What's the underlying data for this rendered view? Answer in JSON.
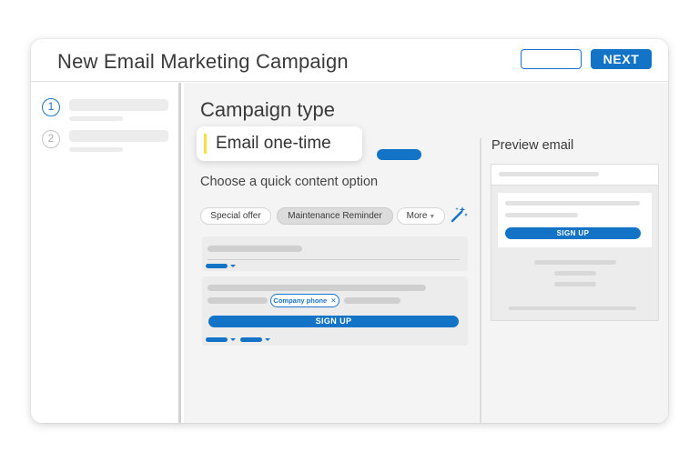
{
  "header": {
    "title": "New Email Marketing Campaign",
    "next_label": "NEXT"
  },
  "sidebar": {
    "steps": [
      {
        "number": "1",
        "state": "active"
      },
      {
        "number": "2",
        "state": "inactive"
      }
    ]
  },
  "main": {
    "title": "Campaign type",
    "selected_type": "Email one-time",
    "subheading": "Choose a quick content option",
    "chips": [
      {
        "label": "Special offer"
      },
      {
        "label": "Maintenance Reminder"
      },
      {
        "label": "More"
      }
    ],
    "tag_label": "Company phone",
    "signup_label": "SIGN UP"
  },
  "preview": {
    "title": "Preview email",
    "signup_label": "SIGN UP"
  },
  "colors": {
    "accent": "#1273c7",
    "highlight": "#f5e142"
  },
  "icons": [
    "chevron-down-icon",
    "magic-wand-icon",
    "close-icon"
  ]
}
